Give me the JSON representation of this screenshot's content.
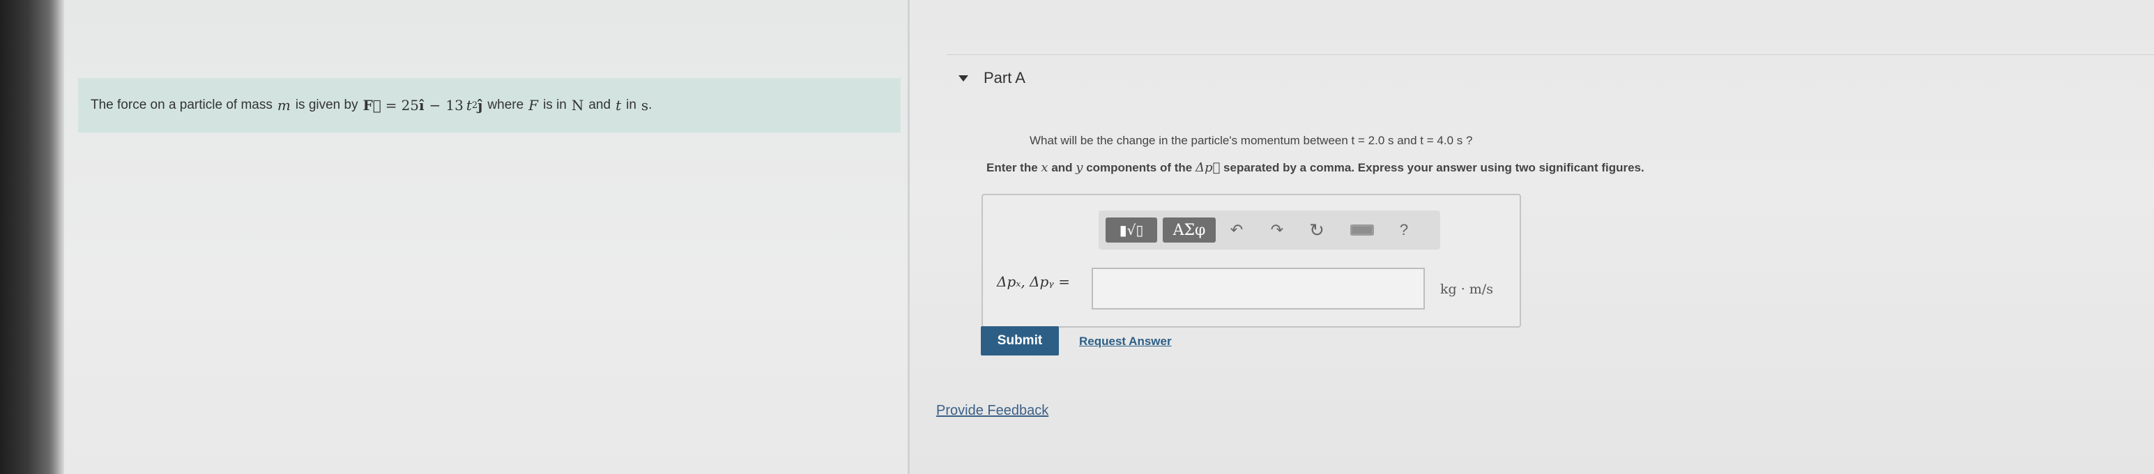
{
  "problem": {
    "prefix": "The force on a particle of mass",
    "mass_symbol": "m",
    "given_by": "is given by",
    "force_vector": "F⃗",
    "equals": "=",
    "coef_i": "25",
    "unit_i": "î",
    "minus": "−",
    "coef_j": "13",
    "t_symbol": "t",
    "exponent": "2",
    "unit_j": "ĵ",
    "where": "where",
    "f_symbol": "F",
    "is_in": "is in",
    "newton": "N",
    "and": "and",
    "t_symbol2": "t",
    "in": "in",
    "seconds": "s",
    "period": "."
  },
  "part": {
    "title": "Part A",
    "question": "What will be the change in the particle's momentum between t = 2.0 s and t = 4.0 s ?",
    "instruction_prefix": "Enter the",
    "x_symbol": "x",
    "and": "and",
    "y_symbol": "y",
    "instruction_middle": "components of the",
    "delta_p": "Δp⃗",
    "instruction_suffix": "separated by a comma. Express your answer using two significant figures."
  },
  "toolbar": {
    "template_icon": "▮√▯",
    "greek_label": "ΑΣφ",
    "undo_icon": "↶",
    "redo_icon": "↷",
    "reset_icon": "↻",
    "help_icon": "?"
  },
  "answer": {
    "label": "Δpₓ, Δpᵧ =",
    "value": "",
    "units": "kg · m/s"
  },
  "actions": {
    "submit_label": "Submit",
    "request_label": "Request Answer",
    "feedback_label": "Provide Feedback"
  },
  "colors": {
    "problem_bg": "#d3e4e0",
    "submit_bg": "#2d5f86",
    "link": "#2d5f86"
  }
}
